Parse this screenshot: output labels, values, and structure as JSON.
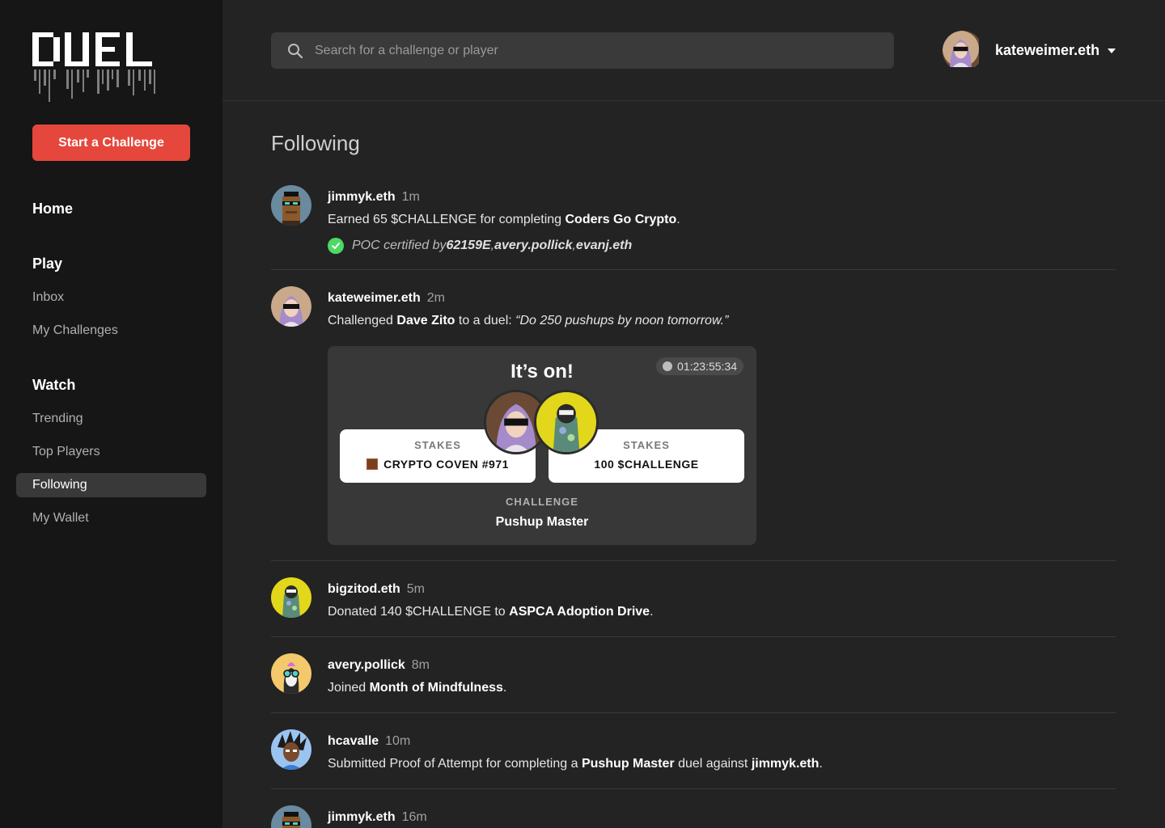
{
  "sidebar": {
    "start_button": "Start a Challenge",
    "home": "Home",
    "play": {
      "heading": "Play",
      "items": [
        "Inbox",
        "My Challenges"
      ]
    },
    "watch": {
      "heading": "Watch",
      "items": [
        "Trending",
        "Top Players",
        "Following",
        "My Wallet"
      ],
      "active": "Following"
    }
  },
  "header": {
    "search_placeholder": "Search for a challenge or player",
    "username": "kateweimer.eth"
  },
  "page_title": "Following",
  "feed": [
    {
      "user": "jimmyk.eth",
      "time": "1m",
      "text_pre": "Earned 65 $CHALLENGE for completing ",
      "bold": "Coders Go Crypto",
      "text_post": ".",
      "poc": {
        "prefix": "POC certified by ",
        "names": [
          "62159E",
          "avery.pollick",
          "evanj.eth"
        ],
        "sep": ", "
      }
    },
    {
      "user": "kateweimer.eth",
      "time": "2m",
      "text_pre": "Challenged ",
      "bold": "Dave Zito",
      "text_mid": " to a duel: ",
      "quote": "“Do 250 pushups by noon tomorrow.”",
      "card": {
        "headline": "It’s on!",
        "timer": "01:23:55:34",
        "left_stake_label": "STAKES",
        "left_stake_value": "CRYPTO COVEN #971",
        "right_stake_label": "STAKES",
        "right_stake_value": "100 $CHALLENGE",
        "challenge_label": "CHALLENGE",
        "challenge_name": "Pushup Master"
      }
    },
    {
      "user": "bigzitod.eth",
      "time": "5m",
      "text_pre": "Donated 140 $CHALLENGE to ",
      "bold": "ASPCA Adoption Drive",
      "text_post": "."
    },
    {
      "user": "avery.pollick",
      "time": "8m",
      "text_pre": "Joined ",
      "bold": "Month of Mindfulness",
      "text_post": "."
    },
    {
      "user": "hcavalle",
      "time": "10m",
      "text_pre": "Submitted Proof of Attempt for completing a ",
      "bold": "Pushup Master",
      "text_mid": " duel against ",
      "bold2": "jimmyk.eth",
      "text_post": "."
    },
    {
      "user": "jimmyk.eth",
      "time": "16m"
    }
  ],
  "colors": {
    "accent": "#e5473c",
    "sidebar_bg": "#161616",
    "main_bg": "#232323",
    "check_green": "#4cd964"
  },
  "icons": {
    "search": "search-icon",
    "caret": "chevron-down-icon",
    "check": "check-circle-icon",
    "timer": "clock-icon"
  }
}
